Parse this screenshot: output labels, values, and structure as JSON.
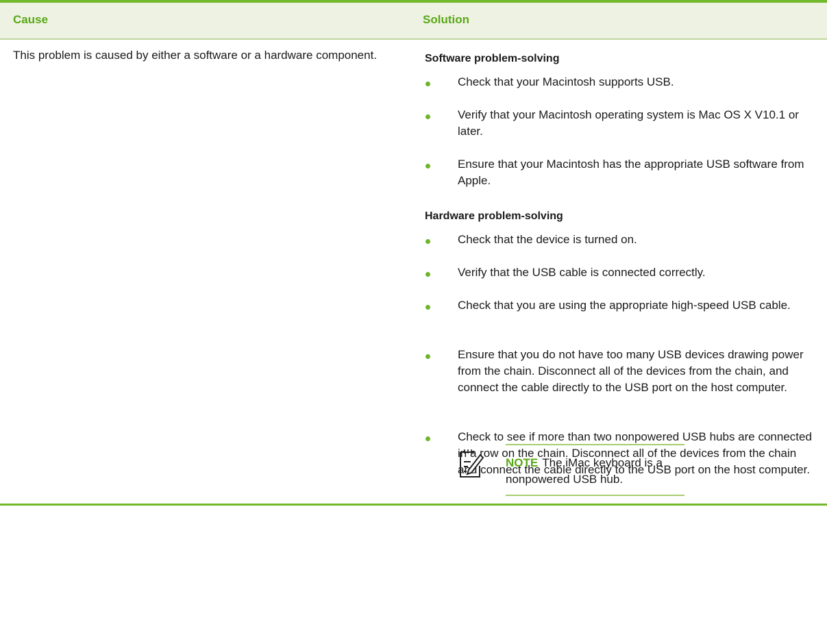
{
  "header": {
    "cause": "Cause",
    "solution": "Solution"
  },
  "cause_text": "This problem is caused by either a software or a hardware component.",
  "software": {
    "title": "Software problem-solving",
    "items": [
      "Check that your Macintosh supports USB.",
      "Verify that your Macintosh operating system is Mac OS X V10.1 or later.",
      "Ensure that your Macintosh has the appropriate USB software from Apple."
    ]
  },
  "hardware": {
    "title": "Hardware problem-solving",
    "items": [
      "Check that the device is turned on.",
      "Verify that the USB cable is connected correctly.",
      "Check that you are using the appropriate high-speed USB cable.",
      "Ensure that you do not have too many USB devices drawing power from the chain. Disconnect all of the devices from the chain, and connect the cable directly to the USB port on the host computer.",
      "Check to see if more than two nonpowered USB hubs are connected in a row on the chain. Disconnect all of the devices from the chain and connect the cable directly to the USB port on the host computer."
    ]
  },
  "note": {
    "label": "NOTE",
    "text": "The iMac keyboard is a nonpowered USB hub.",
    "icon": "note-pencil-icon"
  },
  "colors": {
    "accent": "#73b92c",
    "header_bg": "#eef2e3",
    "heading_text": "#5aa816"
  }
}
